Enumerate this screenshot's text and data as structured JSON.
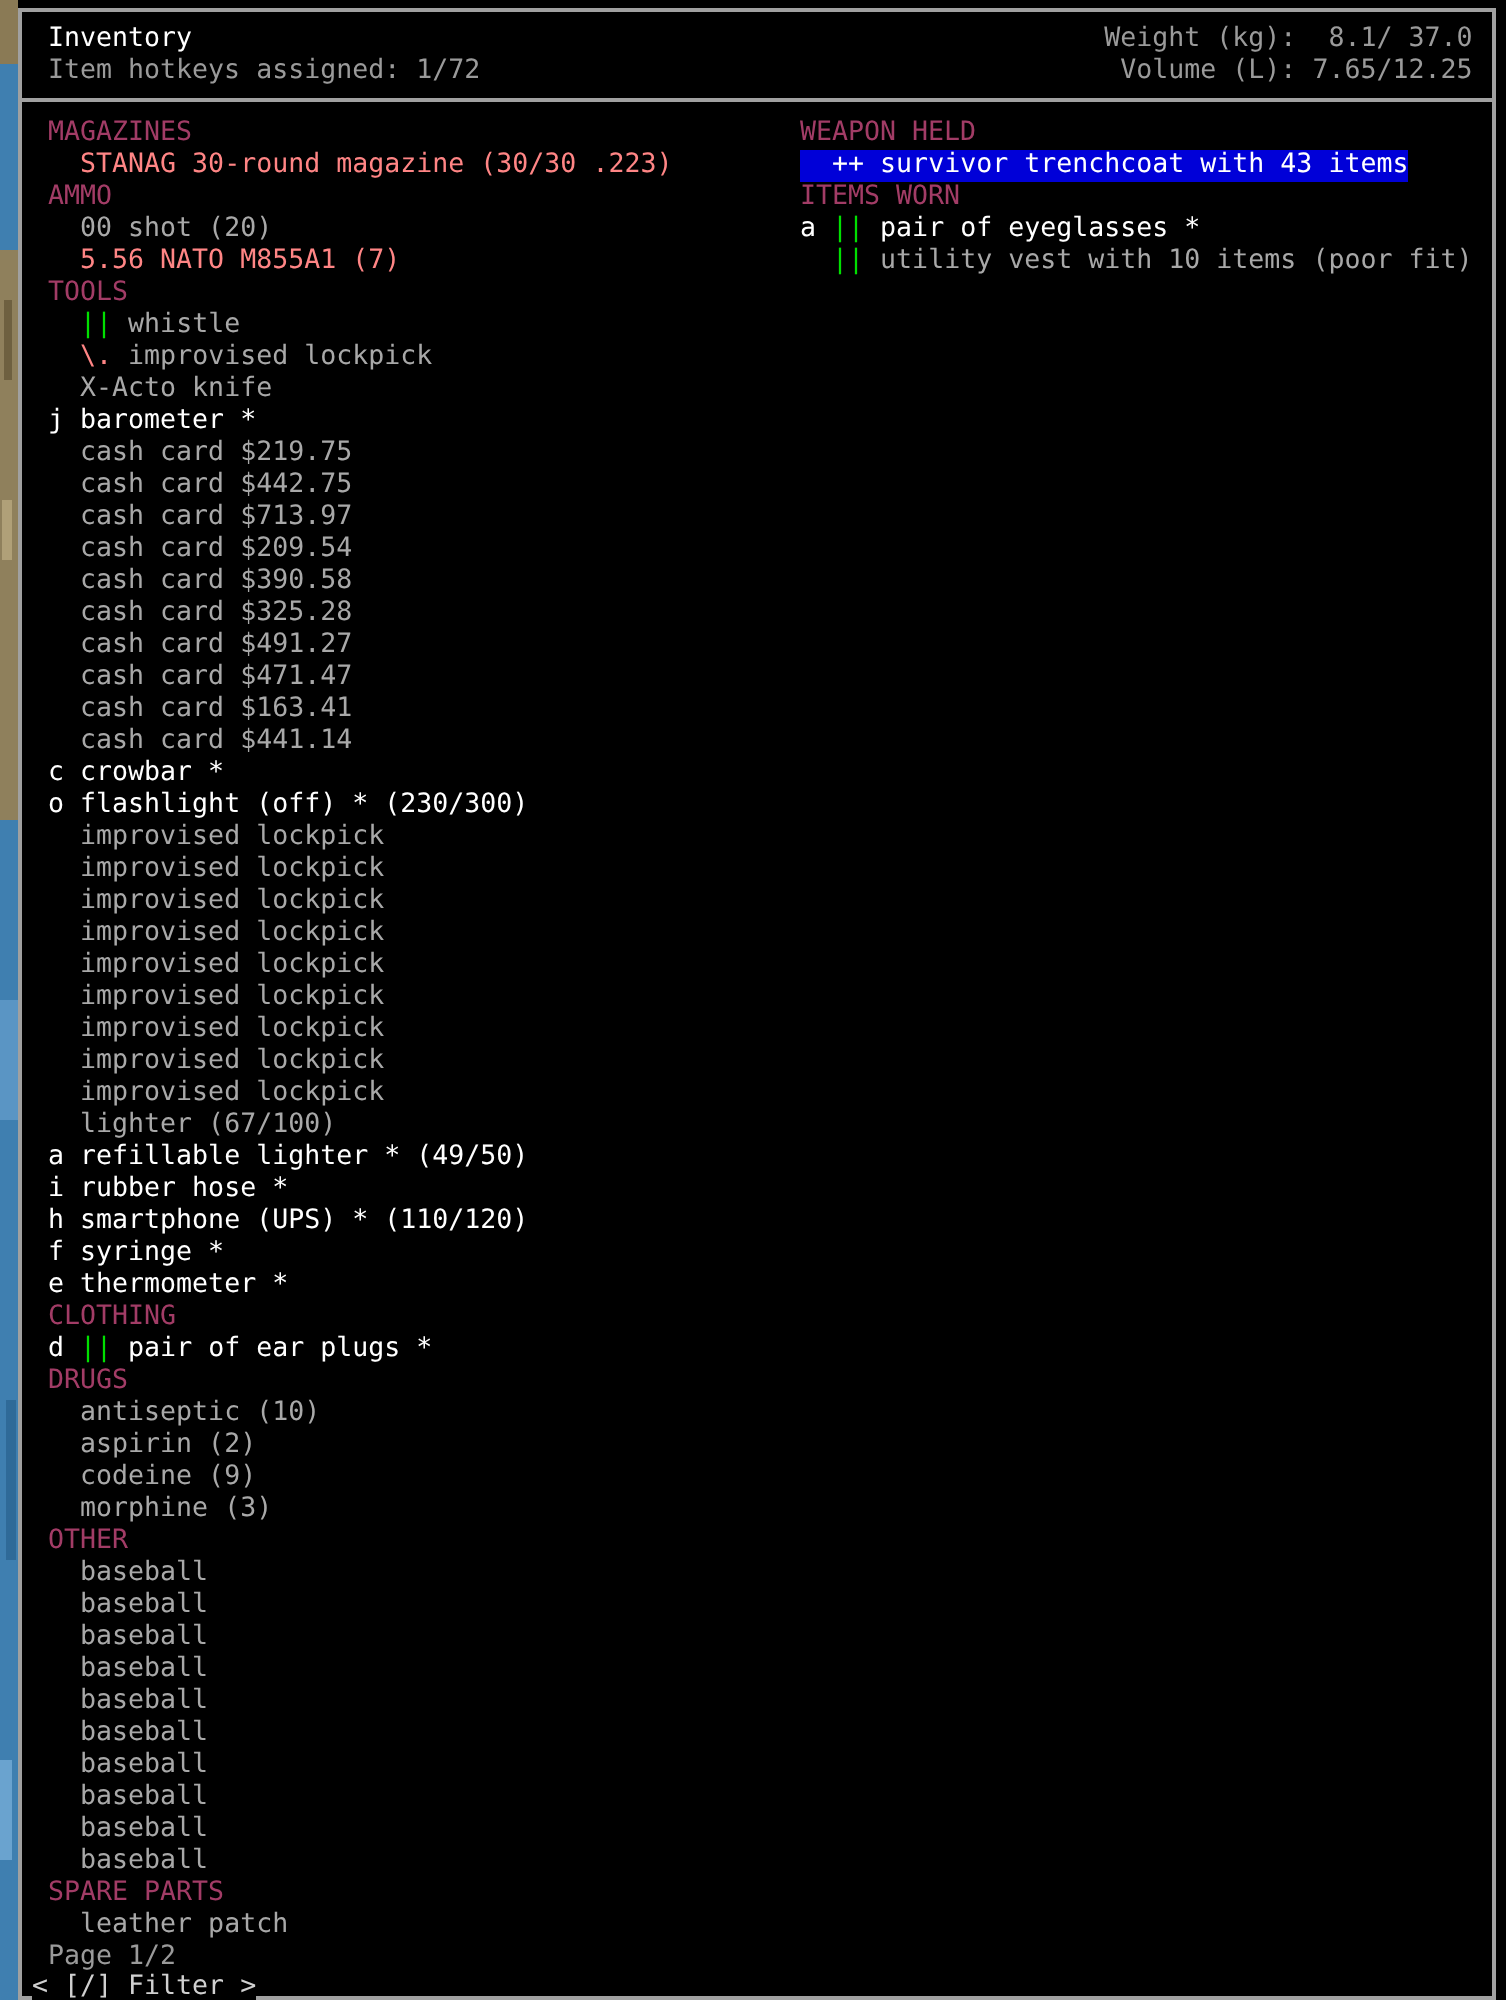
{
  "header": {
    "title": "Inventory",
    "hotkeys": "Item hotkeys assigned: 1/72",
    "weight": "Weight (kg):  8.1/ 37.0",
    "volume": "Volume (L): 7.65/12.25"
  },
  "columns": [
    {
      "sections": [
        {
          "heading": "MAGAZINES",
          "items": [
            {
              "name": "STANAG 30-round magazine (30/30 .223)",
              "kind": "loaded",
              "selected": false
            }
          ]
        },
        {
          "heading": "AMMO",
          "items": [
            {
              "name": "00 shot (20)",
              "kind": "plain",
              "selected": false
            },
            {
              "name": "5.56 NATO M855A1 (7)",
              "kind": "loaded",
              "selected": false
            }
          ]
        },
        {
          "heading": "TOOLS",
          "items": [
            {
              "mark": {
                "text": "||",
                "kind": "worn"
              },
              "name": "whistle",
              "kind": "plain",
              "selected": false
            },
            {
              "mark": {
                "text": "\\.",
                "kind": "damaged"
              },
              "name": "improvised lockpick",
              "kind": "plain",
              "selected": false
            },
            {
              "name": "X-Acto knife",
              "kind": "plain",
              "selected": false
            },
            {
              "key": "j",
              "name": "barometer *",
              "kind": "favorite",
              "selected": false
            },
            {
              "name": "cash card $219.75",
              "kind": "plain",
              "selected": false
            },
            {
              "name": "cash card $442.75",
              "kind": "plain",
              "selected": false
            },
            {
              "name": "cash card $713.97",
              "kind": "plain",
              "selected": false
            },
            {
              "name": "cash card $209.54",
              "kind": "plain",
              "selected": false
            },
            {
              "name": "cash card $390.58",
              "kind": "plain",
              "selected": false
            },
            {
              "name": "cash card $325.28",
              "kind": "plain",
              "selected": false
            },
            {
              "name": "cash card $491.27",
              "kind": "plain",
              "selected": false
            },
            {
              "name": "cash card $471.47",
              "kind": "plain",
              "selected": false
            },
            {
              "name": "cash card $163.41",
              "kind": "plain",
              "selected": false
            },
            {
              "name": "cash card $441.14",
              "kind": "plain",
              "selected": false
            },
            {
              "key": "c",
              "name": "crowbar *",
              "kind": "favorite",
              "selected": false
            },
            {
              "key": "o",
              "name": "flashlight (off) * (230/300)",
              "kind": "favorite",
              "selected": false
            },
            {
              "name": "improvised lockpick",
              "kind": "plain",
              "selected": false
            },
            {
              "name": "improvised lockpick",
              "kind": "plain",
              "selected": false
            },
            {
              "name": "improvised lockpick",
              "kind": "plain",
              "selected": false
            },
            {
              "name": "improvised lockpick",
              "kind": "plain",
              "selected": false
            },
            {
              "name": "improvised lockpick",
              "kind": "plain",
              "selected": false
            },
            {
              "name": "improvised lockpick",
              "kind": "plain",
              "selected": false
            },
            {
              "name": "improvised lockpick",
              "kind": "plain",
              "selected": false
            },
            {
              "name": "improvised lockpick",
              "kind": "plain",
              "selected": false
            },
            {
              "name": "improvised lockpick",
              "kind": "plain",
              "selected": false
            },
            {
              "name": "lighter (67/100)",
              "kind": "plain",
              "selected": false
            },
            {
              "key": "a",
              "name": "refillable lighter * (49/50)",
              "kind": "favorite",
              "selected": false
            },
            {
              "key": "i",
              "name": "rubber hose *",
              "kind": "favorite",
              "selected": false
            },
            {
              "key": "h",
              "name": "smartphone (UPS) * (110/120)",
              "kind": "favorite",
              "selected": false
            },
            {
              "key": "f",
              "name": "syringe *",
              "kind": "favorite",
              "selected": false
            },
            {
              "key": "e",
              "name": "thermometer *",
              "kind": "favorite",
              "selected": false
            }
          ]
        },
        {
          "heading": "CLOTHING",
          "items": [
            {
              "key": "d",
              "mark": {
                "text": "||",
                "kind": "worn"
              },
              "name": "pair of ear plugs *",
              "kind": "favorite",
              "selected": false
            }
          ]
        },
        {
          "heading": "DRUGS",
          "items": [
            {
              "name": "antiseptic (10)",
              "kind": "plain",
              "selected": false
            },
            {
              "name": "aspirin (2)",
              "kind": "plain",
              "selected": false
            },
            {
              "name": "codeine (9)",
              "kind": "plain",
              "selected": false
            },
            {
              "name": "morphine (3)",
              "kind": "plain",
              "selected": false
            }
          ]
        },
        {
          "heading": "OTHER",
          "items": [
            {
              "name": "baseball",
              "kind": "plain",
              "selected": false
            },
            {
              "name": "baseball",
              "kind": "plain",
              "selected": false
            },
            {
              "name": "baseball",
              "kind": "plain",
              "selected": false
            },
            {
              "name": "baseball",
              "kind": "plain",
              "selected": false
            },
            {
              "name": "baseball",
              "kind": "plain",
              "selected": false
            },
            {
              "name": "baseball",
              "kind": "plain",
              "selected": false
            },
            {
              "name": "baseball",
              "kind": "plain",
              "selected": false
            },
            {
              "name": "baseball",
              "kind": "plain",
              "selected": false
            },
            {
              "name": "baseball",
              "kind": "plain",
              "selected": false
            },
            {
              "name": "baseball",
              "kind": "plain",
              "selected": false
            }
          ]
        },
        {
          "heading": "SPARE PARTS",
          "items": [
            {
              "name": "leather patch",
              "kind": "plain",
              "selected": false
            }
          ]
        }
      ]
    },
    {
      "sections": [
        {
          "heading": "WEAPON HELD",
          "items": [
            {
              "mark": {
                "text": "++",
                "kind": "wielded"
              },
              "name": "survivor trenchcoat with 43 items",
              "kind": "favorite",
              "selected": true
            }
          ]
        },
        {
          "heading": "ITEMS WORN",
          "items": [
            {
              "key": "a",
              "mark": {
                "text": "||",
                "kind": "worn"
              },
              "name": "pair of eyeglasses *",
              "kind": "favorite",
              "selected": false
            },
            {
              "mark": {
                "text": "||",
                "kind": "worn"
              },
              "name": "utility vest with 10 items (poor fit)",
              "kind": "plain",
              "selected": false
            }
          ]
        }
      ]
    }
  ],
  "footer": {
    "page": "Page 1/2",
    "filter": "< [/] Filter >"
  }
}
